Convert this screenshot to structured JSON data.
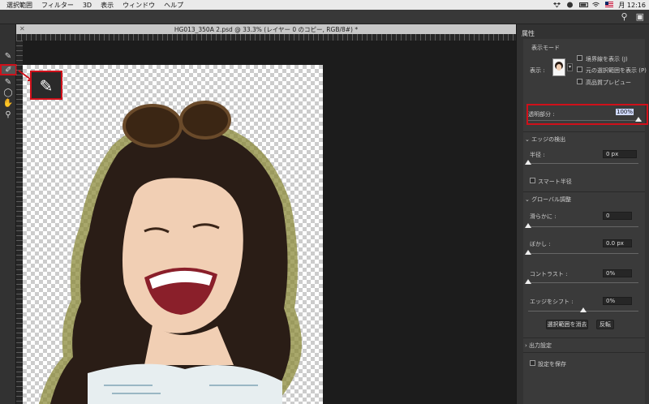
{
  "menubar": {
    "items": [
      "選択範囲",
      "フィルター",
      "3D",
      "表示",
      "ウィンドウ",
      "ヘルプ"
    ],
    "clock": "月 12:16"
  },
  "document": {
    "tab_title": "HG013_350A 2.psd @ 33.3% (レイヤー 0 のコピー, RGB/8#) *"
  },
  "panel": {
    "title": "属性",
    "view_mode": {
      "label": "表示モード",
      "display_label": "表示 :",
      "options": [
        "境界線を表示 (J)",
        "元の選択範囲を表示 (P)",
        "高品質プレビュー"
      ]
    },
    "opacity": {
      "label": "透明部分 :",
      "value": "100%",
      "fraction": 1.0
    },
    "edge_detection": {
      "title": "エッジの検出",
      "radius_label": "半径 :",
      "radius_value": "0 px",
      "radius_fraction": 0.0,
      "smart_radius_label": "スマート半径"
    },
    "global": {
      "title": "グローバル調整",
      "smooth_label": "滑らかに :",
      "smooth_value": "0",
      "smooth_fraction": 0.0,
      "feather_label": "ぼかし :",
      "feather_value": "0.0 px",
      "feather_fraction": 0.0,
      "contrast_label": "コントラスト :",
      "contrast_value": "0%",
      "contrast_fraction": 0.0,
      "shift_label": "エッジをシフト :",
      "shift_value": "0%",
      "shift_fraction": 0.5,
      "clear_button": "選択範囲を消去",
      "invert_button": "反転"
    },
    "output": {
      "title": "出力設定",
      "save_label": "設定を保存"
    }
  }
}
